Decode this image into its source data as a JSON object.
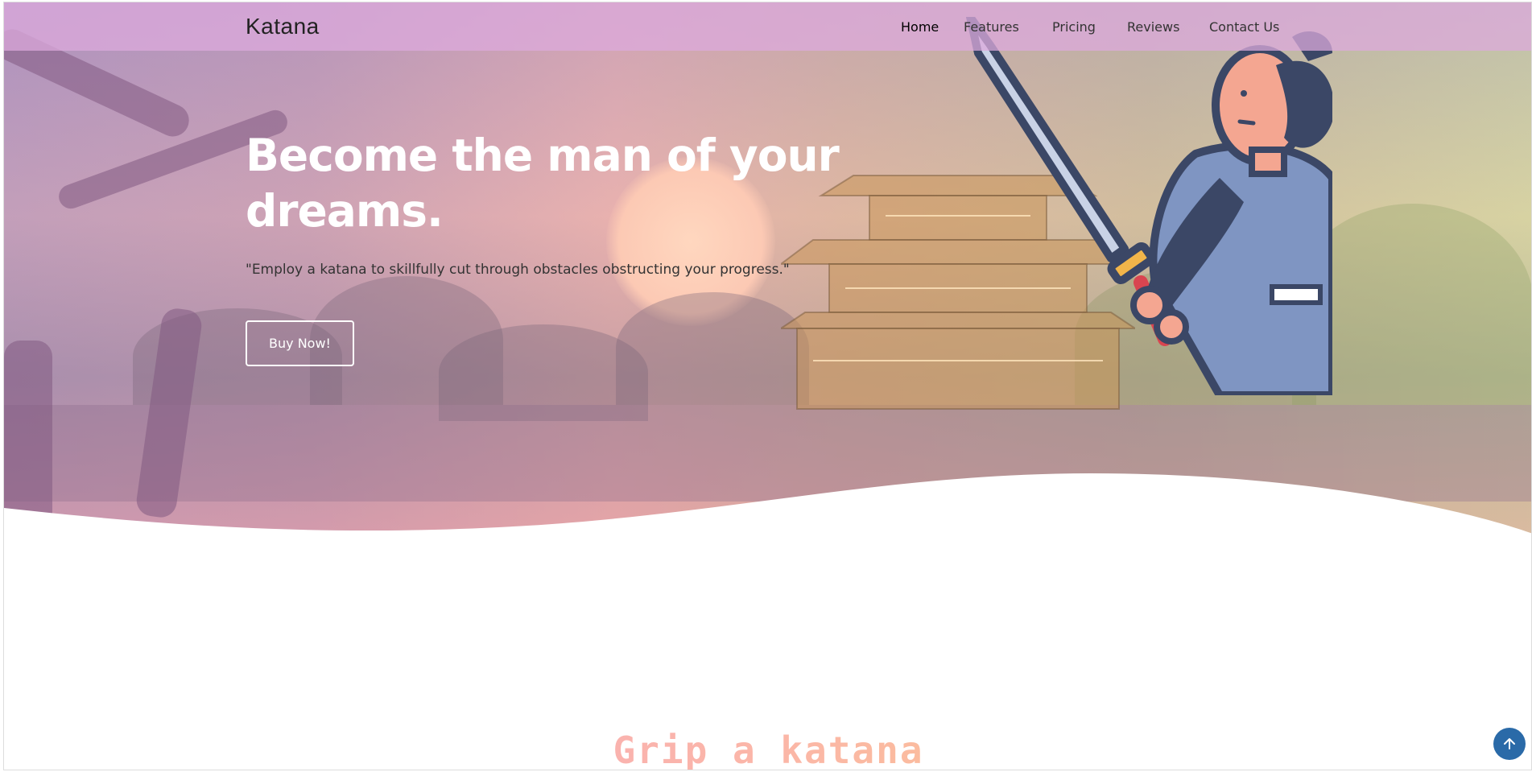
{
  "navbar": {
    "brand": "Katana",
    "links": [
      "Home",
      "Features",
      "Pricing",
      "Reviews",
      "Contact Us"
    ],
    "active": "Home"
  },
  "hero": {
    "headline": "Become the man of your dreams.",
    "quote": "\"Employ a katana to skillfully cut through obstacles obstructing your progress.\"",
    "cta_label": "Buy Now!"
  },
  "section": {
    "tagline": "Grip a katana"
  },
  "scroll_top_icon": "arrow-up-icon",
  "colors": {
    "nav_bg": "#dcaadc",
    "cta_border": "#ffffff",
    "scroll_btn": "#2a6aa8",
    "samurai_robe": "#7f95c2",
    "samurai_outline": "#3b4766"
  }
}
